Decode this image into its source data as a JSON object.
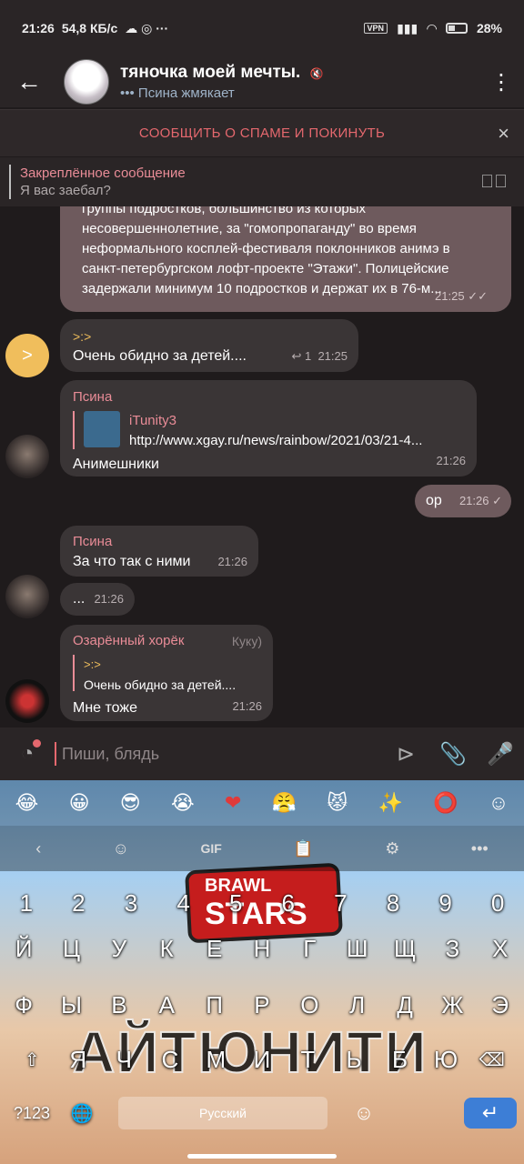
{
  "status": {
    "time": "21:26",
    "speed": "54,8 КБ/с",
    "icons_left": "☁ ◎ ···",
    "vpn": "VPN",
    "battery": "28%"
  },
  "header": {
    "back_icon": "arrow-left-icon",
    "title": "тяночка моей мечты.",
    "status": "••• Псина жмякает",
    "menu_icon": "more-vert-icon"
  },
  "spam": {
    "label": "СООБЩИТЬ О СПАМЕ И ПОКИНУТЬ",
    "close": "×"
  },
  "pinned": {
    "title": "Закреплённое сообщение",
    "text": "Я вас заебал?"
  },
  "messages": {
    "news": {
      "line0": "группы подростков, большинство из которых",
      "line1": "несовершеннолетние, за \"гомопропаганду\" во время",
      "line2": "неформального косплей-фестиваля поклонников анимэ в",
      "line3": "санкт-петербургском лофт-проекте \"Этажи\". Полицейские",
      "line4": "задержали минимум 10 подростков и держат их в 76-м...",
      "time": "21:25"
    },
    "m1": {
      "avatar_letter": ">",
      "sender": ">:>",
      "text": "Очень обидно за детей....",
      "replies": "↩ 1",
      "time": "21:25"
    },
    "m2": {
      "sender": "Псина",
      "link_site": "iTunity3",
      "link_url": "http://www.xgay.ru/news/rainbow/2021/03/21-4...",
      "text": "Анимешники",
      "time": "21:26"
    },
    "m3": {
      "text": "ор",
      "time": "21:26"
    },
    "m4": {
      "sender": "Псина",
      "text": "За что так с ними",
      "time": "21:26"
    },
    "m5": {
      "text": "...",
      "time": "21:26"
    },
    "m6": {
      "sender": "Озарённый хорёк",
      "tag": "Куку)",
      "reply_name": ">:>",
      "reply_text": "Очень обидно за детей....",
      "text": "Мне тоже",
      "time": "21:26"
    }
  },
  "composer": {
    "placeholder": "Пиши, блядь"
  },
  "keyboard": {
    "emoji": [
      "😂",
      "😀",
      "😎",
      "😭",
      "❤",
      "😤",
      "😾",
      "✨",
      "⭕",
      "☺"
    ],
    "tools": [
      "‹",
      "☺",
      "GIF",
      "📋",
      "⚙",
      "•••"
    ],
    "numbers": [
      "1",
      "2",
      "3",
      "4",
      "5",
      "6",
      "7",
      "8",
      "9",
      "0"
    ],
    "row1": [
      "Й",
      "Ц",
      "У",
      "К",
      "Е",
      "Н",
      "Г",
      "Ш",
      "Щ",
      "З",
      "Х"
    ],
    "row2": [
      "Ф",
      "Ы",
      "В",
      "А",
      "П",
      "Р",
      "О",
      "Л",
      "Д",
      "Ж",
      "Э"
    ],
    "row3": [
      "Я",
      "Ч",
      "С",
      "М",
      "И",
      "Т",
      "Ь",
      "Б",
      "Ю"
    ],
    "k123": "?123",
    "space": "Русский",
    "enter": "↵",
    "brand_top": "BRAWL",
    "brand_bottom": "STARS",
    "banner": "АЙТЮНИТИ"
  }
}
